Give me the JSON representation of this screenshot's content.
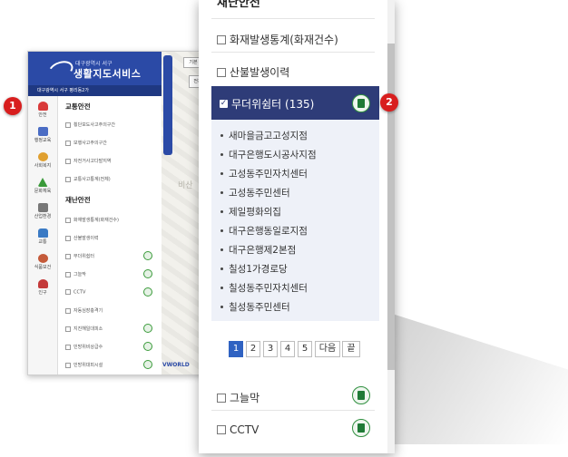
{
  "back_screen": {
    "header_sub": "대구광역시 서구",
    "header_title": "생활지도서비스",
    "location": "대구광역시 서구 평리동2가",
    "sidebar": [
      {
        "label": "안전",
        "icon": "alarm-icon",
        "color": "#d93a3a"
      },
      {
        "label": "행정교육",
        "icon": "building-icon",
        "color": "#4a6cc4"
      },
      {
        "label": "사회복지",
        "icon": "people-icon",
        "color": "#e0a030"
      },
      {
        "label": "문화체육",
        "icon": "mountain-icon",
        "color": "#3a9a3a"
      },
      {
        "label": "산업환경",
        "icon": "factory-icon",
        "color": "#777777"
      },
      {
        "label": "교통",
        "icon": "car-icon",
        "color": "#3a7ac4"
      },
      {
        "label": "식품보건",
        "icon": "food-icon",
        "color": "#c45a3a"
      },
      {
        "label": "인구",
        "icon": "person-icon",
        "color": "#c43a3a"
      }
    ],
    "sections": [
      {
        "title": "교통안전",
        "items": [
          "횡단보도사고주의구간",
          "보행사고주의구간",
          "자전거사고다발지역",
          "교통사고통계(전체)"
        ]
      },
      {
        "title": "재난안전",
        "items": [
          "화재발생통계(화재건수)",
          "산불발생이력",
          "무더위쉼터",
          "그늘막",
          "CCTV",
          "자동심장충격기",
          "지진해일대피소",
          "민방위비상급수",
          "민방위대피시설"
        ]
      }
    ],
    "map_buttons": [
      "기본",
      "전체"
    ],
    "map_label": "비산",
    "map_brand": "VWORLD"
  },
  "callouts": [
    "1",
    "2"
  ],
  "panel": {
    "top_cut_title": "재난안전",
    "categories_above": [
      "화재발생통계(화재건수)",
      "산불발생이력"
    ],
    "selected": {
      "label": "무더위쉼터 (135)",
      "checked": true
    },
    "shelters": [
      "새마을금고고성지점",
      "대구은행도시공사지점",
      "고성동주민자치센터",
      "고성동주민센터",
      "제일평화의집",
      "대구은행동일로지점",
      "대구은행제2본점",
      "칠성1가경로당",
      "칠성동주민자치센터",
      "칠성동주민센터"
    ],
    "pagination": [
      "1",
      "2",
      "3",
      "4",
      "5",
      "다음",
      "끝"
    ],
    "active_page": "1",
    "categories_below": [
      "그늘막",
      "CCTV"
    ],
    "colors": {
      "selected_bg": "#2e3c78",
      "sublist_bg": "#eef1f8",
      "accent": "#2f62c2",
      "badge": "#d81e1e"
    }
  }
}
